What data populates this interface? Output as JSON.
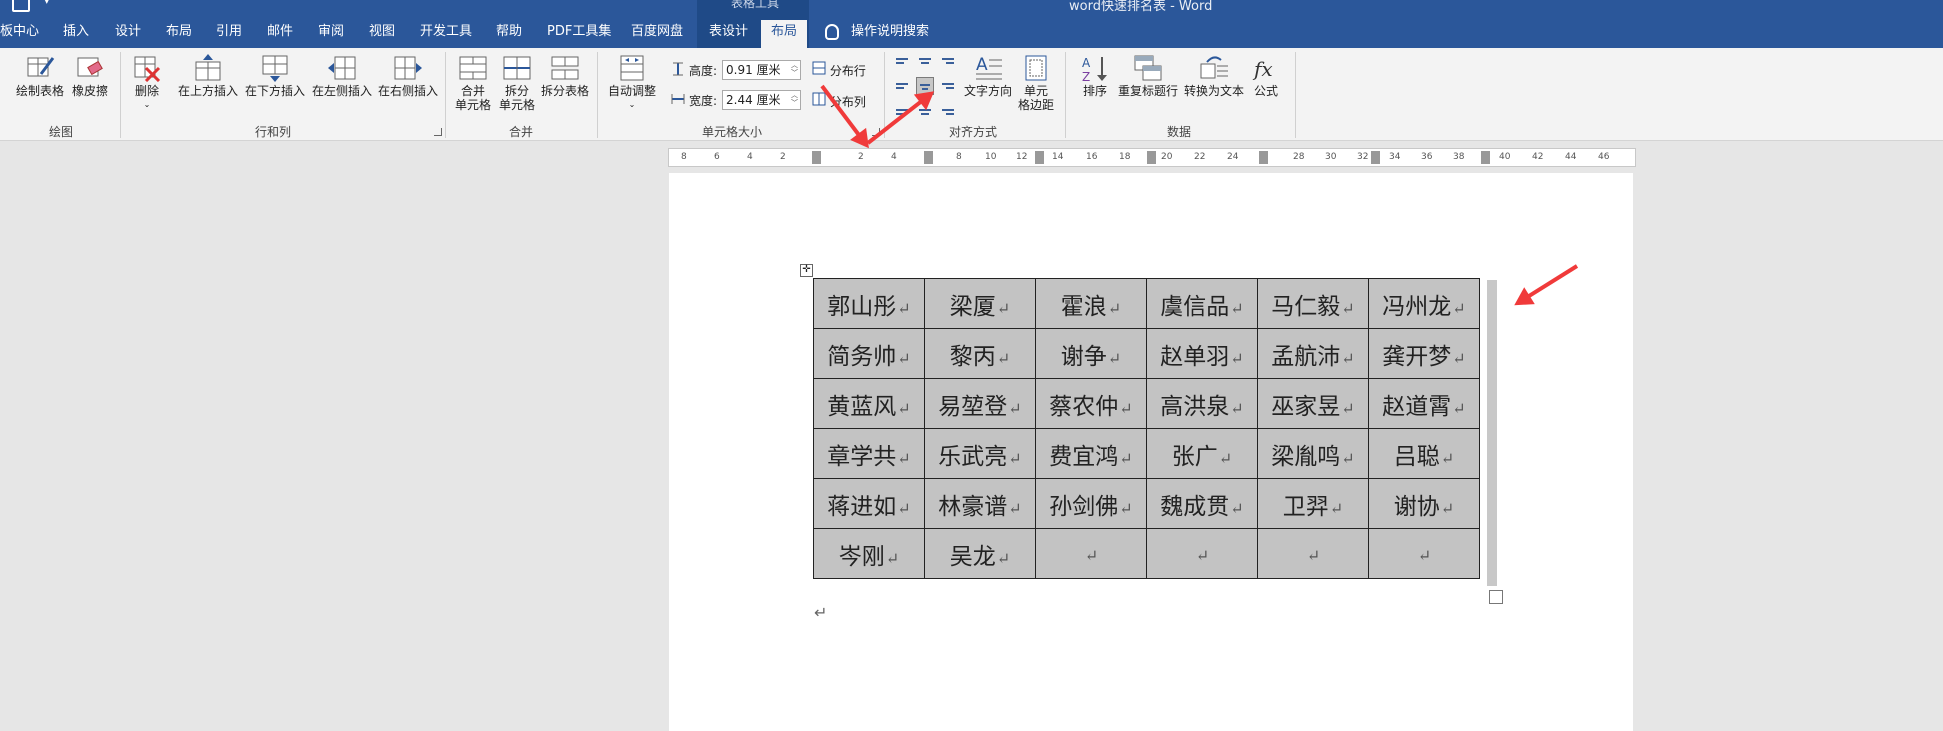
{
  "window": {
    "title": "word快速排名表 - Word",
    "tools_group": "表格工具"
  },
  "tabs": [
    {
      "label": "板中心"
    },
    {
      "label": "插入"
    },
    {
      "label": "设计"
    },
    {
      "label": "布局"
    },
    {
      "label": "引用"
    },
    {
      "label": "邮件"
    },
    {
      "label": "审阅"
    },
    {
      "label": "视图"
    },
    {
      "label": "开发工具"
    },
    {
      "label": "帮助"
    },
    {
      "label": "PDF工具集"
    },
    {
      "label": "百度网盘"
    },
    {
      "label": "表设计"
    },
    {
      "label": "布局"
    },
    {
      "label": "操作说明搜索"
    }
  ],
  "ribbon": {
    "draw": {
      "label": "绘图",
      "draw_table": "绘制表格",
      "eraser": "橡皮擦"
    },
    "rows_cols": {
      "label": "行和列",
      "delete": "删除",
      "insert_above": "在上方插入",
      "insert_below": "在下方插入",
      "insert_left": "在左侧插入",
      "insert_right": "在右侧插入"
    },
    "merge": {
      "label": "合并",
      "merge_cells_1": "合并",
      "merge_cells_2": "单元格",
      "split_cells_1": "拆分",
      "split_cells_2": "单元格",
      "split_table": "拆分表格"
    },
    "cell_size": {
      "label": "单元格大小",
      "autofit": "自动调整",
      "height_label": "高度:",
      "height_value": "0.91 厘米",
      "width_label": "宽度:",
      "width_value": "2.44 厘米",
      "distribute_rows": "分布行",
      "distribute_cols": "分布列"
    },
    "alignment": {
      "label": "对齐方式",
      "text_direction": "文字方向",
      "cell_margins_1": "单元",
      "cell_margins_2": "格边距"
    },
    "data": {
      "label": "数据",
      "sort": "排序",
      "repeat_header": "重复标题行",
      "convert_text": "转换为文本",
      "formula": "公式"
    }
  },
  "ruler": {
    "marks": [
      "8",
      "6",
      "4",
      "2",
      "2",
      "4",
      "8",
      "10",
      "12",
      "14",
      "16",
      "18",
      "20",
      "22",
      "24",
      "28",
      "30",
      "32",
      "34",
      "36",
      "38",
      "40",
      "42",
      "44",
      "46"
    ]
  },
  "table": {
    "rows": [
      [
        "郭山彤",
        "梁厦",
        "霍浪",
        "虞信品",
        "马仁毅",
        "冯州龙"
      ],
      [
        "简务帅",
        "黎丙",
        "谢争",
        "赵单羽",
        "孟航沛",
        "龚开梦"
      ],
      [
        "黄蓝风",
        "易堃登",
        "蔡农仲",
        "高洪泉",
        "巫家昱",
        "赵道霄"
      ],
      [
        "章学共",
        "乐武亮",
        "费宜鸿",
        "张广",
        "梁胤鸣",
        "吕聪"
      ],
      [
        "蒋进如",
        "林豪谱",
        "孙剑佛",
        "魏成贯",
        "卫羿",
        "谢协"
      ],
      [
        "岑刚",
        "吴龙",
        "",
        "",
        "",
        ""
      ]
    ],
    "cell_mark": "↵",
    "move_handle": "✛"
  },
  "colors": {
    "title_bar": "#2b579a",
    "tools_group": "#1f4a87",
    "cell_shading": "#c3c3c3",
    "arrow": "#f03a3a"
  }
}
